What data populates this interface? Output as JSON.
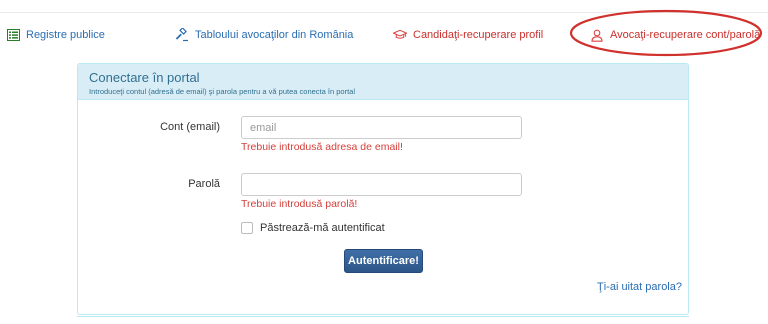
{
  "nav": {
    "items": [
      {
        "label": "Registre publice",
        "icon": "list-icon"
      },
      {
        "label": "Tabloului avocaţilor din România",
        "icon": "gavel-icon"
      },
      {
        "label": "Candidaţi-recuperare profil",
        "icon": "graduation-cap-icon"
      },
      {
        "label": "Avocaţi-recuperare cont/parolă",
        "icon": "user-icon"
      }
    ]
  },
  "panel": {
    "title": "Conectare în portal",
    "subtitle": "Introduceţi contul (adresă de email) şi parola pentru a vă putea conecta în portal"
  },
  "form": {
    "email_label": "Cont (email)",
    "email_placeholder": "email",
    "email_value": "",
    "email_error": "Trebuie introdusă adresa de email!",
    "password_label": "Parolă",
    "password_value": "",
    "password_error": "Trebuie introdusă parolă!",
    "remember_label": "Păstrează-mă autentificat",
    "remember_checked": false,
    "submit_label": "Autentificare!",
    "forgot_label": "Ţi-ai uitat parola?"
  },
  "colors": {
    "panel_header_bg": "#d9edf7",
    "panel_border": "#bce8f1",
    "link": "#2a6db3",
    "error": "#d43f3a",
    "highlight": "#c9302c",
    "button": "#2d5689"
  }
}
